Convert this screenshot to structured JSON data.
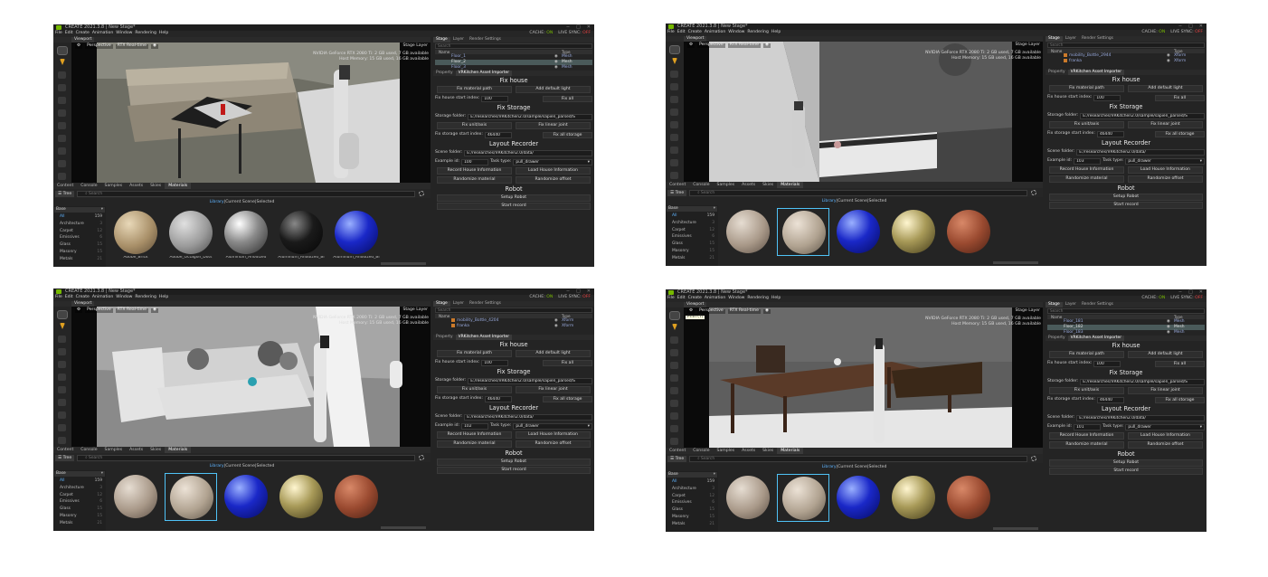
{
  "app": {
    "title": "CREATE 2021.3.8 | New Stage*",
    "menu": [
      "File",
      "Edit",
      "Create",
      "Animation",
      "Window",
      "Rendering",
      "Help"
    ],
    "cache_label": "CACHE:",
    "cache_value": "ON",
    "livesync_label": "LIVE SYNC:",
    "livesync_value": "OFF",
    "viewport_tab": "Viewport",
    "camera": "Perspective",
    "renderer": "RTX Real-time",
    "stage_layer": "Stage Layer",
    "gpu_line": "NVIDIA GeForce RTX 2080 Ti: 2 GB used, 7 GB available",
    "host_line": "Host Memory: 15 GB used, 16 GB available"
  },
  "colors": {
    "accent": "#76b900",
    "link": "#5fb4ff",
    "selection": "#4fc3f7",
    "off": "#e04040"
  },
  "tools": [
    "nvidia-logo-icon",
    "select-arrow-icon",
    "move-icon",
    "rotate-icon",
    "scale-icon",
    "snap-icon",
    "magnet-icon",
    "play-icon",
    "step-icon",
    "physics-icon",
    "paint-icon"
  ],
  "bottom_tabs": [
    "Content",
    "Console",
    "Samples",
    "Assets",
    "Skies",
    "Materials"
  ],
  "browser": {
    "tree_label": "Tree",
    "search_placeholder": "Search",
    "lib_tabs": [
      "Library",
      "Current Scene",
      "Selected"
    ],
    "base_label": "Base"
  },
  "categories": [
    {
      "name": "All",
      "count": "159"
    },
    {
      "name": "Architecture",
      "count": "3"
    },
    {
      "name": "Carpet",
      "count": "12"
    },
    {
      "name": "Emissives",
      "count": "6"
    },
    {
      "name": "Glass",
      "count": "15"
    },
    {
      "name": "Masonry",
      "count": "15"
    },
    {
      "name": "Metals",
      "count": "21"
    }
  ],
  "stage_tabs": [
    "Stage",
    "Layer",
    "Render Settings"
  ],
  "stage_search": "Search",
  "stage_cols": {
    "name": "Name",
    "type": "Type"
  },
  "prop_tabs": [
    "Property",
    "VRKitchen Asset Importer"
  ],
  "importer": {
    "fix_house": "Fix house",
    "fix_material": "Fix material path",
    "add_light": "Add default light",
    "fix_start_label": "Fix house start index:",
    "fix_start_value": "100",
    "fix_all": "Fix all",
    "fix_storage": "Fix Storage",
    "storage_label": "Storage folder:",
    "storage_value": "E:/researches/VRKitchen2.0/sample/sapien_parsed/S",
    "fix_unit": "Fix unit/axis",
    "fix_joint": "Fix linear joint",
    "storage_start_label": "Fix storage start index:",
    "storage_start_value": "46440",
    "fix_all_storage": "Fix all storage",
    "layout_recorder": "Layout Recorder",
    "scene_label": "Scene folder:",
    "scene_value": "E:/researches/VRKitchen2.0/data/",
    "example_label": "Example id:",
    "task_label": "Task type:",
    "task_value": "pull_drawer",
    "record_house": "Record House Information",
    "load_house": "Load House Information",
    "rand_material": "Randomize material",
    "rand_offset": "Randomize offset",
    "robot": "Robot",
    "setup_robot": "Setup Robot",
    "start_record": "Start record"
  },
  "panels": [
    {
      "example_id": "100",
      "stage_rows": [
        {
          "name": "Floor_1",
          "type": "Mesh",
          "sel": false
        },
        {
          "name": "Floor_2",
          "type": "Mesh",
          "sel": true
        },
        {
          "name": "Floor_3",
          "type": "Mesh",
          "sel": false
        }
      ],
      "materials": [
        "Adobe_Brick",
        "Adobe_Octagon_Dots",
        "Aluminum_Anodized",
        "Aluminum_Anodized_Bl",
        "Aluminum_Anodized_Bl"
      ],
      "tooltip": ""
    },
    {
      "example_id": "103",
      "stage_rows": [
        {
          "name": "mobility_Bottle_2944",
          "type": "Xform",
          "sel": false
        },
        {
          "name": "franka",
          "type": "Xform",
          "sel": false
        }
      ],
      "materials": [
        "",
        "",
        "",
        "",
        ""
      ],
      "tooltip": ""
    },
    {
      "example_id": "102",
      "stage_rows": [
        {
          "name": "mobility_Bottle_4204",
          "type": "Xform",
          "sel": false
        },
        {
          "name": "franka",
          "type": "Xform",
          "sel": false
        }
      ],
      "materials": [
        "",
        "",
        "",
        "",
        ""
      ],
      "tooltip": ""
    },
    {
      "example_id": "101",
      "stage_rows": [
        {
          "name": "Floor_181",
          "type": "Mesh",
          "sel": false
        },
        {
          "name": "Floor_182",
          "type": "Mesh",
          "sel": true
        },
        {
          "name": "Floor_183",
          "type": "Mesh",
          "sel": false
        }
      ],
      "materials": [
        "",
        "",
        "",
        "",
        ""
      ],
      "tooltip": "Prim (T)"
    }
  ]
}
